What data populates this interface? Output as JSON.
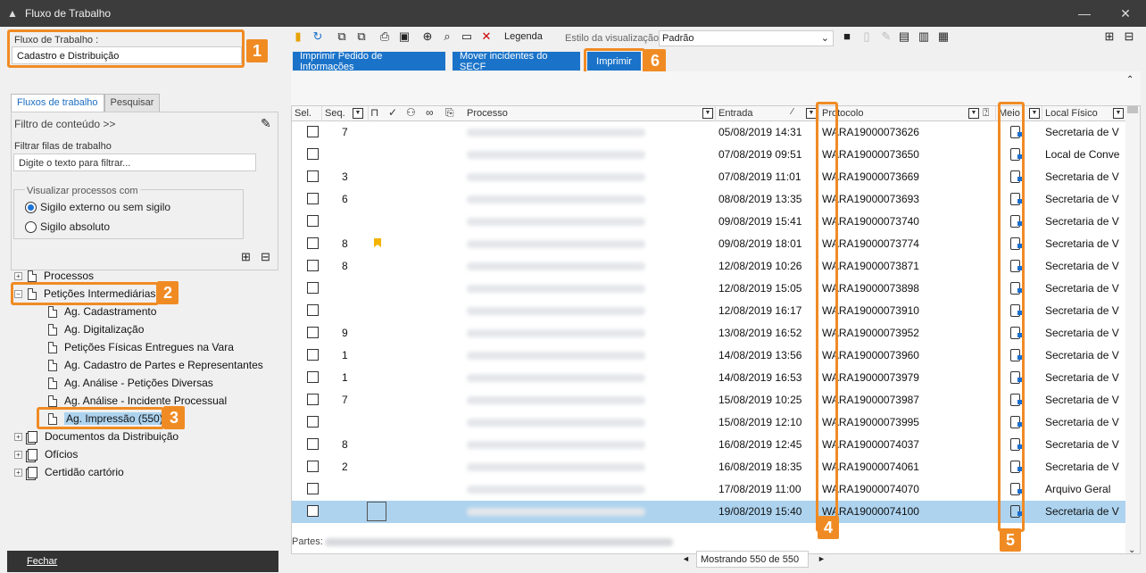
{
  "window": {
    "title": "Fluxo de Trabalho",
    "minimize": "—",
    "close": "✕"
  },
  "left": {
    "workflow_label": "Fluxo de Trabalho :",
    "workflow_value": "Cadastro e Distribuição",
    "tabs": [
      "Fluxos de trabalho",
      "Pesquisar"
    ],
    "filter_content": "Filtro de conteúdo >>",
    "filter_queues_label": "Filtrar filas de trabalho",
    "filter_placeholder": "Digite o texto para filtrar...",
    "view_group": "Visualizar processos com",
    "radio1": "Sigilo externo ou sem sigilo",
    "radio2": "Sigilo absoluto",
    "tree": [
      {
        "label": "Processos"
      },
      {
        "label": "Petições Intermediárias"
      },
      {
        "label": "Ag. Cadastramento"
      },
      {
        "label": "Ag. Digitalização"
      },
      {
        "label": "Petições Físicas Entregues na Vara"
      },
      {
        "label": "Ag. Cadastro de Partes e Representantes"
      },
      {
        "label": "Ag. Análise - Petições Diversas"
      },
      {
        "label": "Ag. Análise - Incidente Processual"
      },
      {
        "label": "Ag. Impressão (550)"
      },
      {
        "label": "Documentos da Distribuição"
      },
      {
        "label": "Ofícios"
      },
      {
        "label": "Certidão cartório"
      }
    ],
    "close_button": "Fechar"
  },
  "toolbar": {
    "legend": "Legenda",
    "view_style_label": "Estilo da visualização",
    "view_style_value": "Padrão",
    "btn_print_request": "Imprimir Pedido de Informações",
    "btn_move": "Mover incidentes do SECF",
    "btn_print": "Imprimir"
  },
  "grid": {
    "headers": {
      "sel": "Sel.",
      "seq": "Seq.",
      "processo": "Processo",
      "entrada": "Entrada",
      "protocolo": "Protocolo",
      "meio": "Meio",
      "local": "Local Físico"
    },
    "rows": [
      {
        "seq": "7",
        "entrada": "05/08/2019 14:31",
        "protocolo": "WARA19000073626",
        "local": "Secretaria de V"
      },
      {
        "seq": "",
        "entrada": "07/08/2019 09:51",
        "protocolo": "WARA19000073650",
        "local": "Local de Conve"
      },
      {
        "seq": "3",
        "entrada": "07/08/2019 11:01",
        "protocolo": "WARA19000073669",
        "local": "Secretaria de V"
      },
      {
        "seq": "6",
        "entrada": "08/08/2019 13:35",
        "protocolo": "WARA19000073693",
        "local": "Secretaria de V"
      },
      {
        "seq": "",
        "entrada": "09/08/2019 15:41",
        "protocolo": "WARA19000073740",
        "local": "Secretaria de V"
      },
      {
        "seq": "8",
        "entrada": "09/08/2019 18:01",
        "protocolo": "WARA19000073774",
        "local": "Secretaria de V",
        "flag": true
      },
      {
        "seq": "8",
        "entrada": "12/08/2019 10:26",
        "protocolo": "WARA19000073871",
        "local": "Secretaria de V"
      },
      {
        "seq": "",
        "entrada": "12/08/2019 15:05",
        "protocolo": "WARA19000073898",
        "local": "Secretaria de V"
      },
      {
        "seq": "",
        "entrada": "12/08/2019 16:17",
        "protocolo": "WARA19000073910",
        "local": "Secretaria de V"
      },
      {
        "seq": "9",
        "entrada": "13/08/2019 16:52",
        "protocolo": "WARA19000073952",
        "local": "Secretaria de V"
      },
      {
        "seq": "1",
        "entrada": "14/08/2019 13:56",
        "protocolo": "WARA19000073960",
        "local": "Secretaria de V"
      },
      {
        "seq": "1",
        "entrada": "14/08/2019 16:53",
        "protocolo": "WARA19000073979",
        "local": "Secretaria de V"
      },
      {
        "seq": "7",
        "entrada": "15/08/2019 10:25",
        "protocolo": "WARA19000073987",
        "local": "Secretaria de V"
      },
      {
        "seq": "",
        "entrada": "15/08/2019 12:10",
        "protocolo": "WARA19000073995",
        "local": "Secretaria de V"
      },
      {
        "seq": "8",
        "entrada": "16/08/2019 12:45",
        "protocolo": "WARA19000074037",
        "local": "Secretaria de V"
      },
      {
        "seq": "2",
        "entrada": "16/08/2019 18:35",
        "protocolo": "WARA19000074061",
        "local": "Secretaria de V"
      },
      {
        "seq": "",
        "entrada": "17/08/2019 11:00",
        "protocolo": "WARA19000074070",
        "local": "Arquivo Geral"
      },
      {
        "seq": "",
        "entrada": "19/08/2019 15:40",
        "protocolo": "WARA19000074100",
        "local": "Secretaria de V",
        "selected": true
      }
    ]
  },
  "footer": {
    "partes_label": "Partes:",
    "pager": "Mostrando 550 de 550",
    "prev": "◄",
    "next": "►"
  },
  "callouts": [
    "1",
    "2",
    "3",
    "4",
    "5",
    "6"
  ],
  "colors": {
    "callout": "#f08b24",
    "button": "#1a73c9",
    "selected_row": "#add3ef"
  }
}
